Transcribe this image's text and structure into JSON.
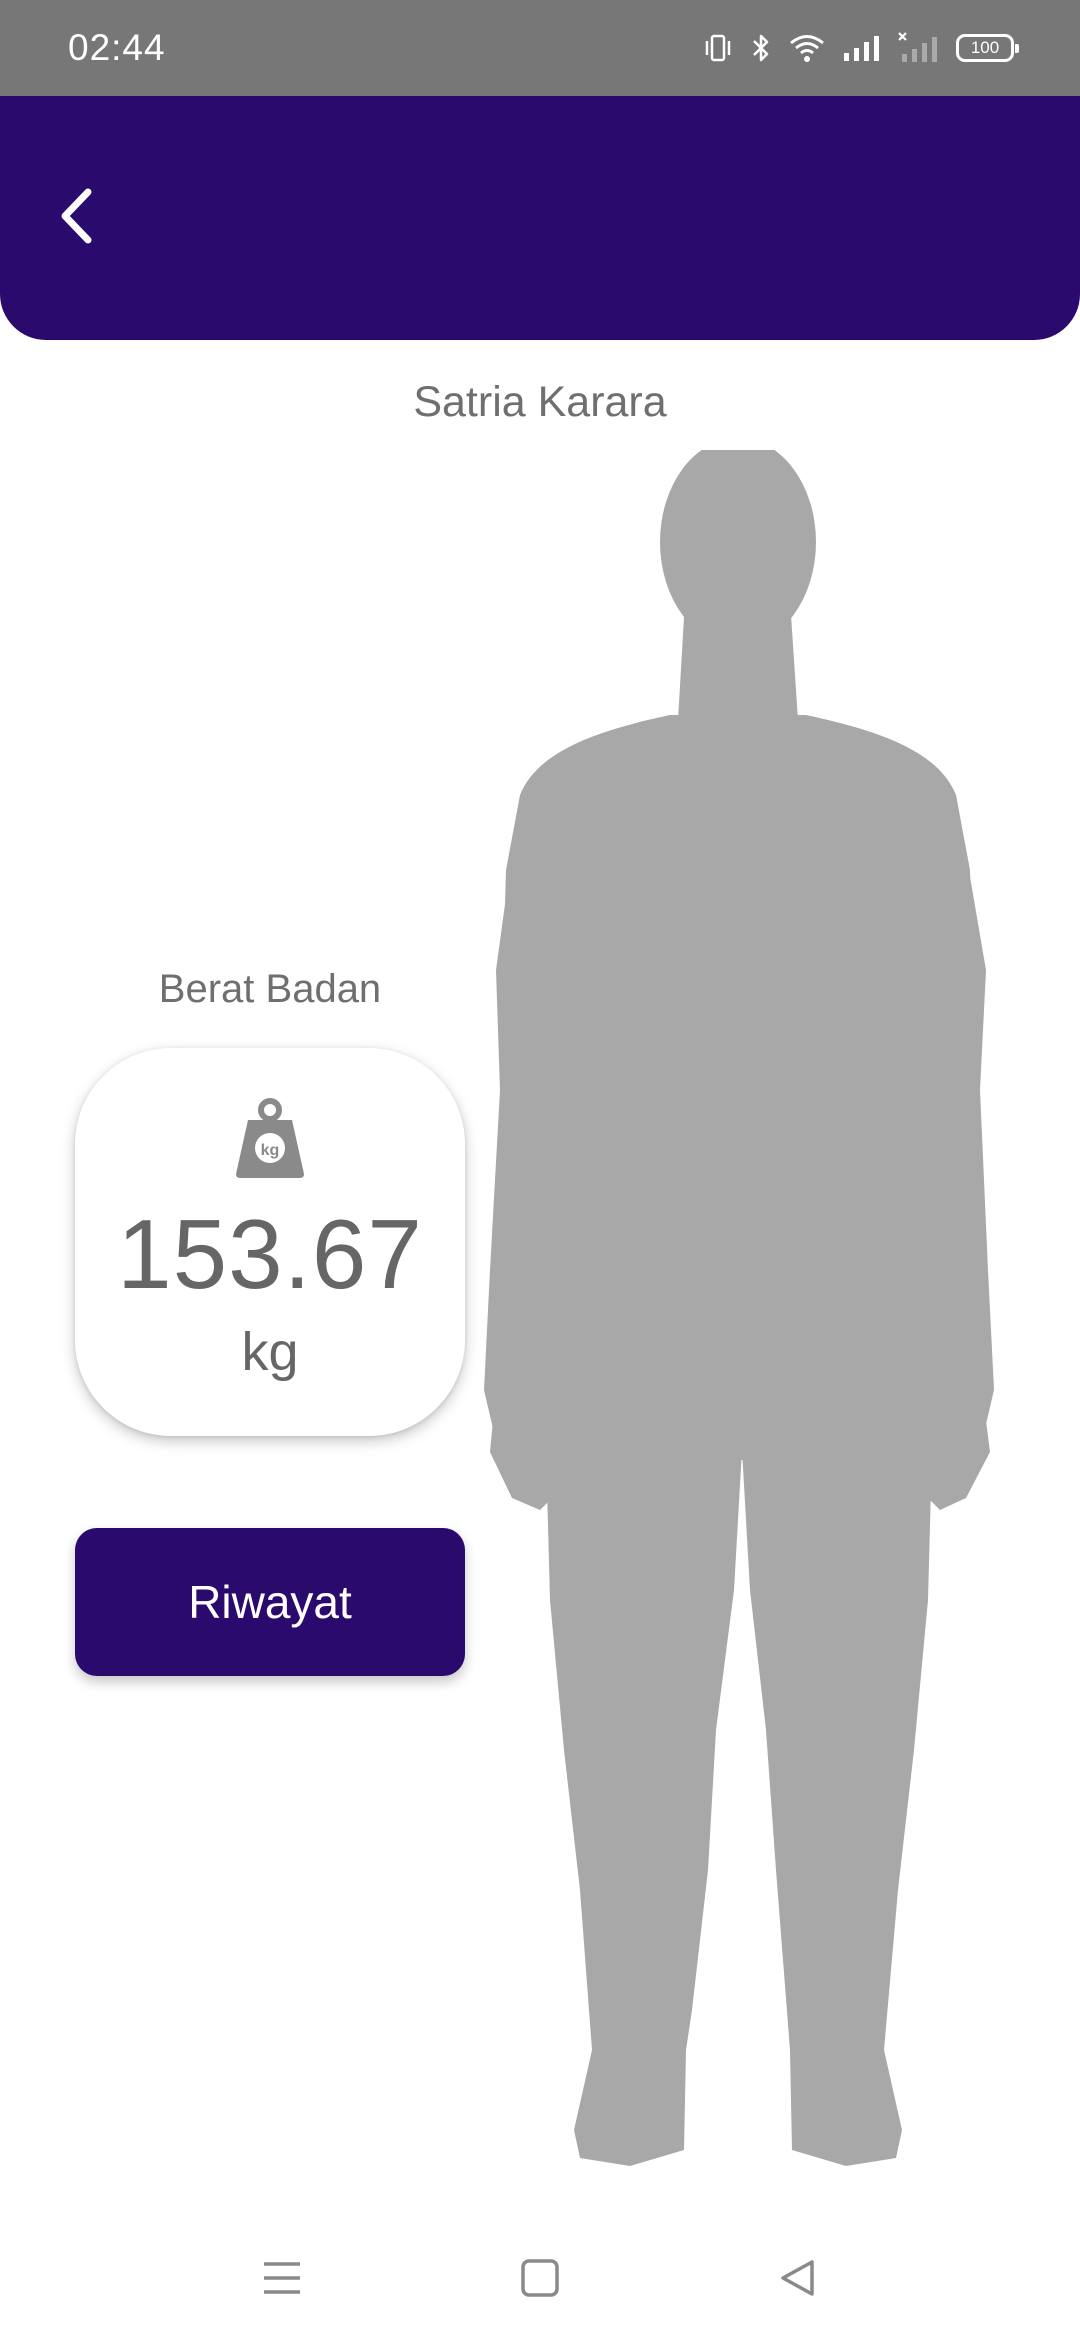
{
  "status_bar": {
    "time": "02:44",
    "icons": [
      "vibrate-icon",
      "bluetooth-icon",
      "wifi-icon",
      "signal-icon",
      "signal-no-service-icon",
      "battery-icon"
    ],
    "battery_level": "100"
  },
  "header": {
    "back_icon": "chevron-left-icon",
    "background": "#2b0a6e"
  },
  "profile": {
    "name": "Satria Karara",
    "figure_icon": "human-body-silhouette"
  },
  "weight": {
    "label": "Berat Badan",
    "icon": "weight-kg-icon",
    "icon_text": "kg",
    "value": "153.67",
    "unit": "kg"
  },
  "actions": {
    "history_label": "Riwayat"
  },
  "nav_bar": {
    "items": [
      "menu-icon",
      "home-square-icon",
      "back-triangle-icon"
    ]
  },
  "colors": {
    "accent": "#2b0a6e",
    "status_bar": "#777777",
    "figure": "#a8a8a8",
    "text_muted": "#6f6f6f"
  }
}
